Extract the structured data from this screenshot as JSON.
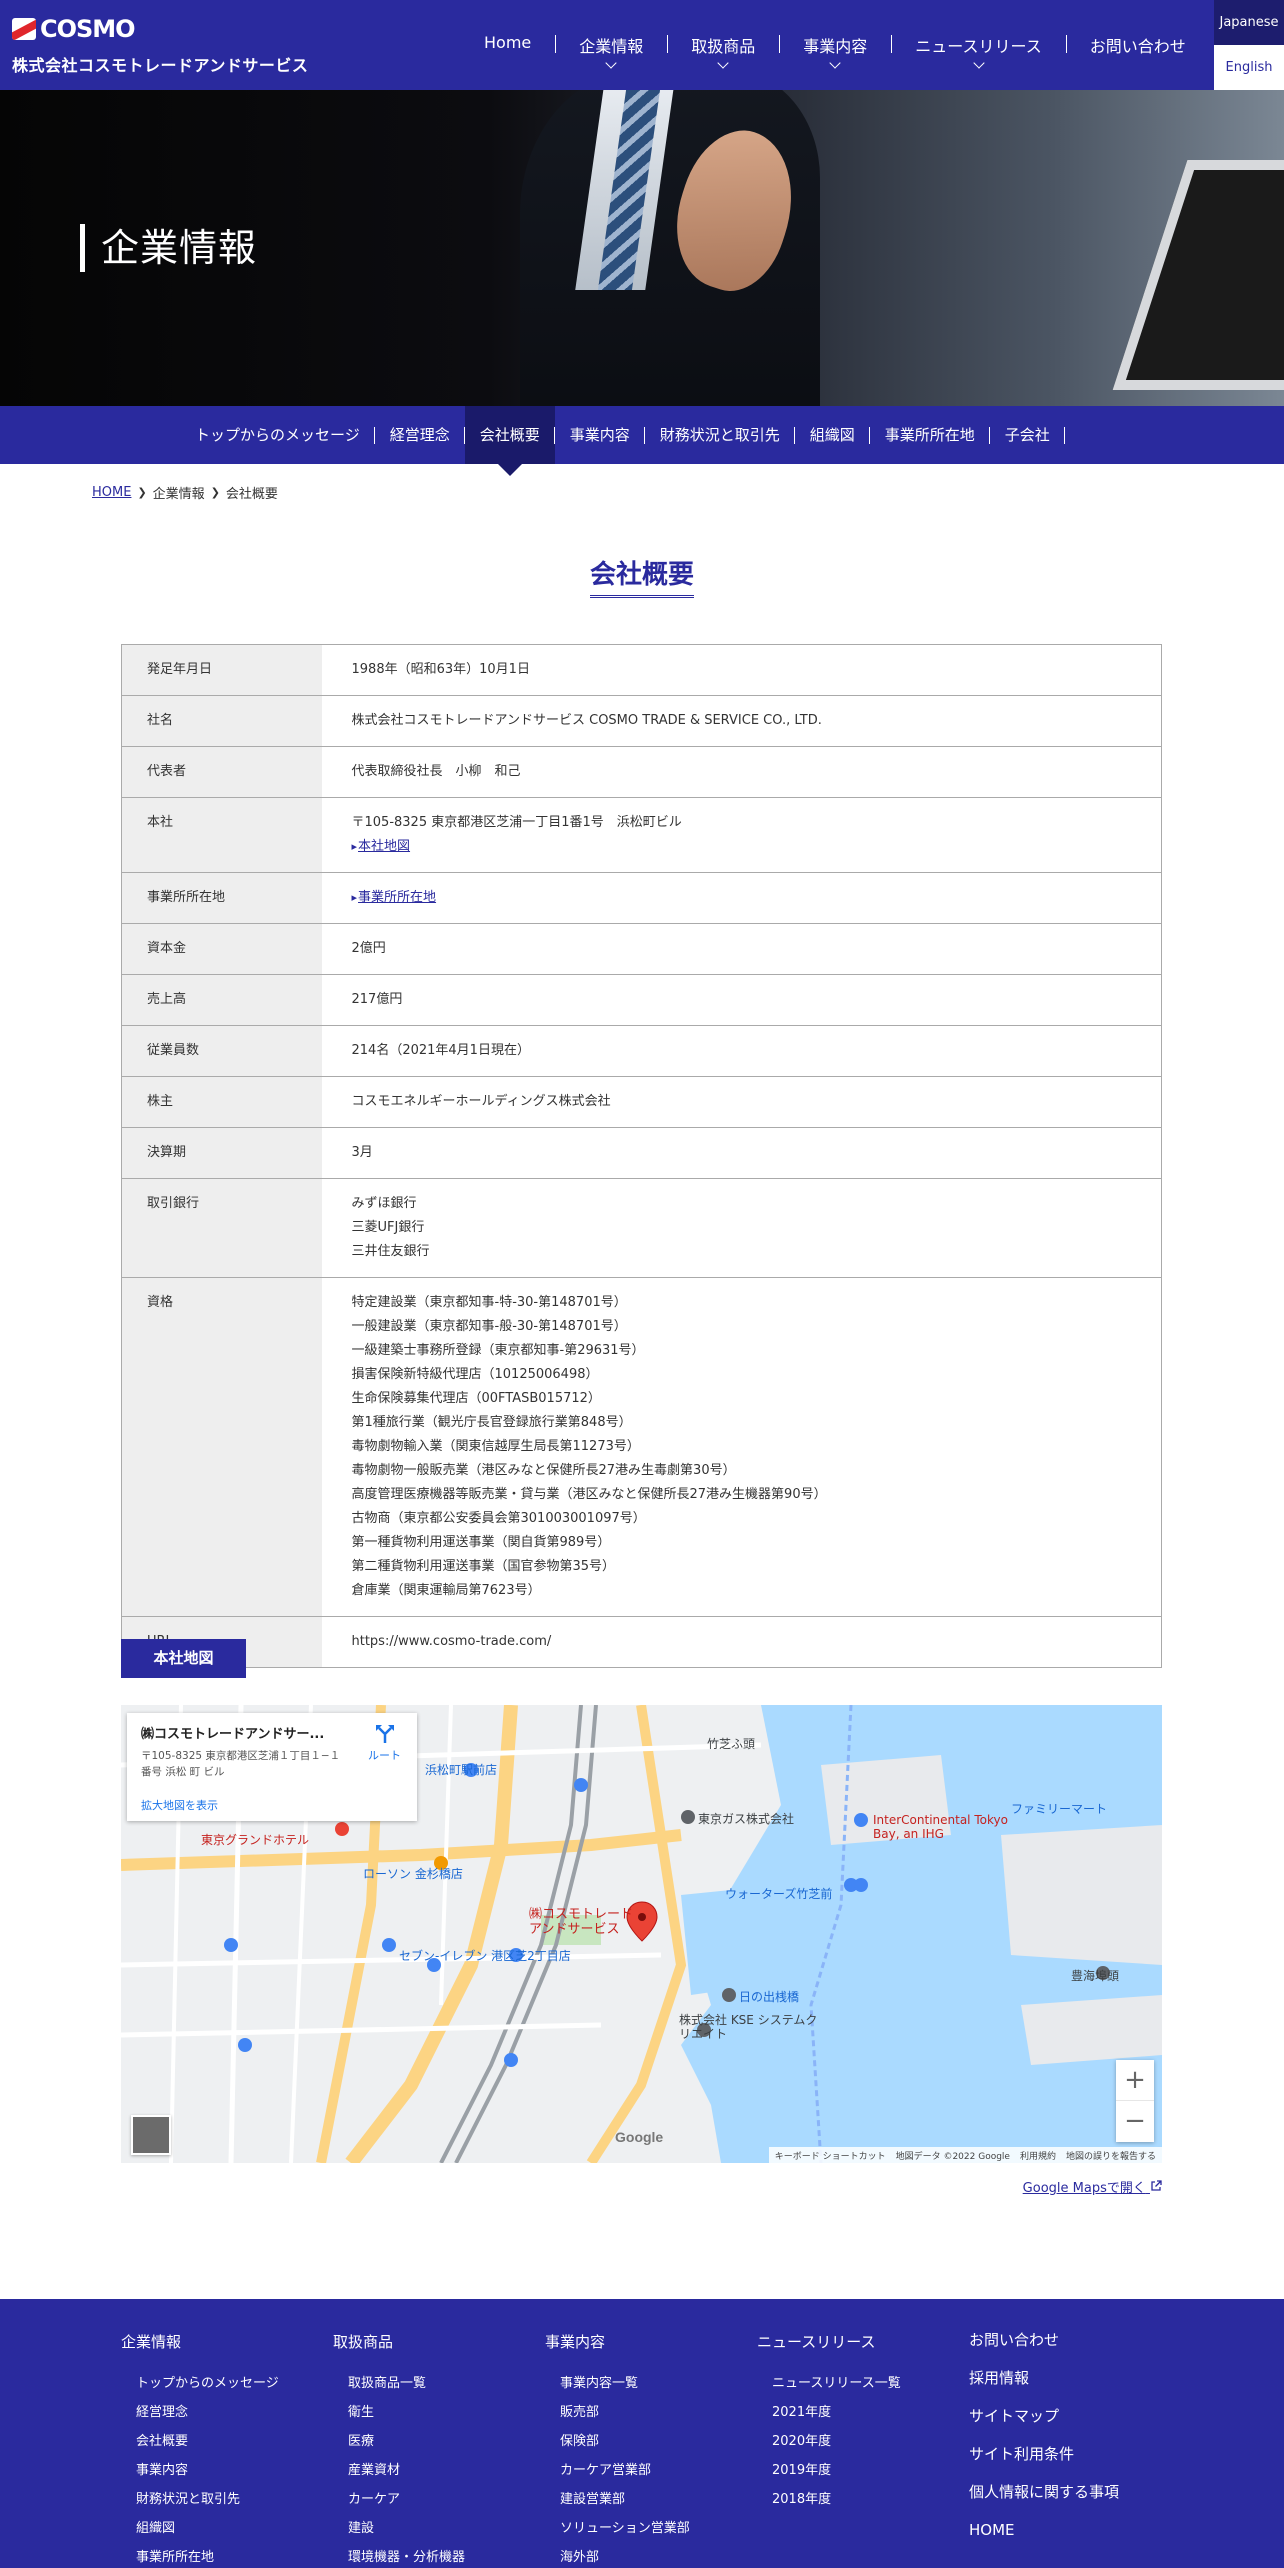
{
  "header": {
    "logo_text": "COSMO",
    "company_name": "株式会社コスモトレードアンドサービス",
    "nav": [
      {
        "label": "Home",
        "has_dropdown": false
      },
      {
        "label": "企業情報",
        "has_dropdown": true
      },
      {
        "label": "取扱商品",
        "has_dropdown": true
      },
      {
        "label": "事業内容",
        "has_dropdown": true
      },
      {
        "label": "ニュースリリース",
        "has_dropdown": true
      },
      {
        "label": "お問い合わせ",
        "has_dropdown": false
      }
    ],
    "lang_ja": "Japanese",
    "lang_en": "English"
  },
  "hero": {
    "title": "企業情報"
  },
  "subnav": {
    "items": [
      "トップからのメッセージ",
      "経営理念",
      "会社概要",
      "事業内容",
      "財務状況と取引先",
      "組織図",
      "事業所所在地",
      "子会社"
    ],
    "active_index": 2
  },
  "breadcrumb": {
    "home": "HOME",
    "level1": "企業情報",
    "current": "会社概要"
  },
  "page_title": "会社概要",
  "company_table": {
    "rows": [
      {
        "label": "発足年月日",
        "lines": [
          "1988年（昭和63年）10月1日"
        ]
      },
      {
        "label": "社名",
        "lines": [
          "株式会社コスモトレードアンドサービス COSMO TRADE & SERVICE CO., LTD."
        ]
      },
      {
        "label": "代表者",
        "lines": [
          "代表取締役社長　小柳　和己"
        ]
      },
      {
        "label": "本社",
        "lines": [
          "〒105-8325 東京都港区芝浦一丁目1番1号　浜松町ビル"
        ],
        "link": "本社地図"
      },
      {
        "label": "事業所所在地",
        "lines": [],
        "link": "事業所所在地"
      },
      {
        "label": "資本金",
        "lines": [
          "2億円"
        ]
      },
      {
        "label": "売上高",
        "lines": [
          "217億円"
        ]
      },
      {
        "label": "従業員数",
        "lines": [
          "214名（2021年4月1日現在）"
        ]
      },
      {
        "label": "株主",
        "lines": [
          "コスモエネルギーホールディングス株式会社"
        ]
      },
      {
        "label": "決算期",
        "lines": [
          "3月"
        ]
      },
      {
        "label": "取引銀行",
        "lines": [
          "みずほ銀行",
          "三菱UFJ銀行",
          "三井住友銀行"
        ]
      },
      {
        "label": "資格",
        "lines": [
          "特定建設業（東京都知事-特-30-第148701号）",
          "一般建設業（東京都知事-般-30-第148701号）",
          "一級建築士事務所登録（東京都知事-第29631号）",
          "損害保険新特級代理店（10125006498）",
          "生命保険募集代理店（00FTASB015712）",
          "第1種旅行業（観光庁長官登録旅行業第848号）",
          "毒物劇物輸入業（関東信越厚生局長第11273号）",
          "毒物劇物一般販売業（港区みなと保健所長27港み生毒劇第30号）",
          "高度管理医療機器等販売業・貸与業（港区みなと保健所長27港み生機器第90号）",
          "古物商（東京都公安委員会第301003001097号）",
          "第一種貨物利用運送事業（関自貨第989号）",
          "第二種貨物利用運送事業（国官参物第35号）",
          "倉庫業（関東運輸局第7623号）"
        ]
      },
      {
        "label": "URL",
        "lines": [
          "https://www.cosmo-trade.com/"
        ]
      }
    ]
  },
  "map_section": {
    "label": "本社地図",
    "card_title": "㈱コスモトレードアンドサー...",
    "card_address": "〒105-8325 東京都港区芝浦１丁目１−１ 番号 浜松 町 ビル",
    "card_link": "拡大地図を表示",
    "route_label": "ルート",
    "marker_label_1": "㈱コスモトレード",
    "marker_label_2": "アンドサービス",
    "place_labels": [
      "東京ガス株式会社",
      "浜松町駅前店",
      "竹芝ふ頭",
      "日の出桟橋",
      "東京グランドホテル",
      "ローソン 金杉橋店",
      "InterContinental Tokyo Bay, an IHG",
      "ウォーターズ竹芝前",
      "株式会社 KSE システムクリエイト",
      "セブン-イレブン 港区芝2丁目店",
      "ファミリーマート",
      "豊海埠頭"
    ],
    "zoom_in": "+",
    "zoom_out": "−",
    "google_logo": "Google",
    "footer_items": [
      "キーボード ショートカット",
      "地図データ ©2022 Google",
      "利用規約",
      "地図の誤りを報告する"
    ],
    "gmaps_link": "Google Mapsで開く"
  },
  "footer": {
    "columns": [
      {
        "head": "企業情報",
        "items": [
          "トップからのメッセージ",
          "経営理念",
          "会社概要",
          "事業内容",
          "財務状況と取引先",
          "組織図",
          "事業所所在地"
        ]
      },
      {
        "head": "取扱商品",
        "items": [
          "取扱商品一覧",
          "衛生",
          "医療",
          "産業資材",
          "カーケア",
          "建設",
          "環境機器・分析機器"
        ]
      },
      {
        "head": "事業内容",
        "items": [
          "事業内容一覧",
          "販売部",
          "保険部",
          "カーケア営業部",
          "建設営業部",
          "ソリューション営業部",
          "海外部"
        ]
      },
      {
        "head": "ニュースリリース",
        "items": [
          "ニュースリリース一覧",
          "2021年度",
          "2020年度",
          "2019年度",
          "2018年度"
        ]
      }
    ],
    "links": [
      "お問い合わせ",
      "採用情報",
      "サイトマップ",
      "サイト利用条件",
      "個人情報に関する事項",
      "HOME"
    ]
  },
  "colors": {
    "brand": "#2a2a9e",
    "brand_dark": "#1a1a6a",
    "table_header_bg": "#eeeeee"
  }
}
